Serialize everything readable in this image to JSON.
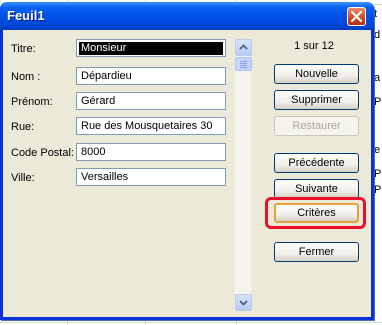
{
  "window": {
    "title": "Feuil1"
  },
  "fields": [
    {
      "label": "Titre:",
      "value": "Monsieur"
    },
    {
      "label": "Nom :",
      "value": "Dépardieu"
    },
    {
      "label": "Prénom:",
      "value": "Gérard"
    },
    {
      "label": "Rue:",
      "value": "Rue des Mousquetaires 30"
    },
    {
      "label": "Code Postal:",
      "value": "8000"
    },
    {
      "label": "Ville:",
      "value": "Versailles"
    }
  ],
  "record_counter": "1 sur 12",
  "buttons": {
    "nouvelle": "Nouvelle",
    "supprimer": "Supprimer",
    "restaurer": "Restaurer",
    "precedente": "Précédente",
    "suivante": "Suivante",
    "criteres": "Critères",
    "fermer": "Fermer"
  },
  "sheet_fragments": [
    "t",
    "d",
    "a",
    "P",
    "e",
    "P",
    "P"
  ],
  "colors": {
    "highlight_ring": "#e8102a",
    "titlebar": "#0050e6"
  }
}
